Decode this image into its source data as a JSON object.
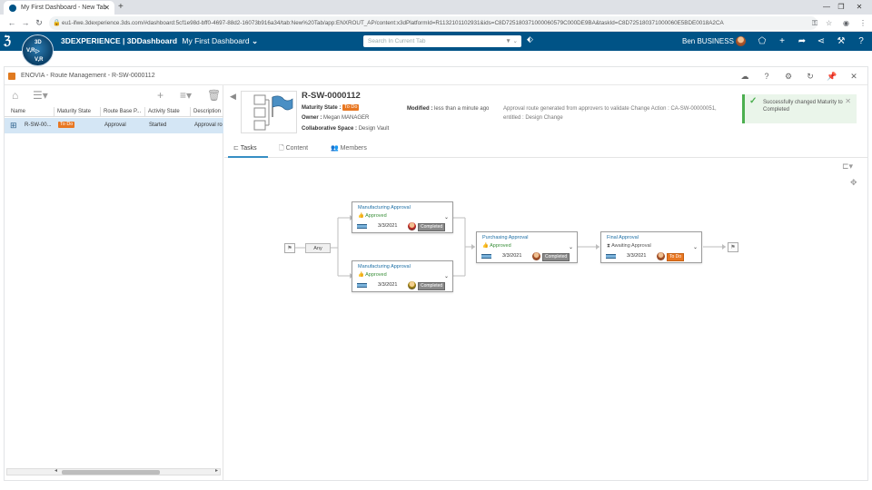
{
  "browser": {
    "tab_title": "My First Dashboard - New Tab",
    "url": "eu1-ifwe.3dexperience.3ds.com/#dashboard:5cf1e98d-bff0-4697-88d2-16073b916a34/tab:New%20Tab/app:ENXROUT_AP/content:x3dPlatformId=R1132101102931&ids=C8D725180371000060579C000DE9BA&taskId=C8D725180371000060E5BDE0018A2CA"
  },
  "topbar": {
    "brand": "3DEXPERIENCE | 3DDashboard",
    "dashboard": "My First Dashboard",
    "search_placeholder": "Search In Current Tab",
    "user": "Ben BUSINESS",
    "compass": {
      "top": "3D",
      "left": "V,R",
      "right": "",
      "bottom": "V,R"
    }
  },
  "app": {
    "title": "ENOVIA - Route Management - R-SW-0000112"
  },
  "list": {
    "columns": [
      "Name",
      "Maturity State",
      "Route Base P...",
      "Activity State",
      "Description"
    ],
    "rows": [
      {
        "name": "R-SW-00...",
        "maturity": "To Do",
        "route_base": "Approval",
        "activity": "Started",
        "description": "Approval ro"
      }
    ]
  },
  "object": {
    "title": "R-SW-0000112",
    "maturity_label": "Maturity State :",
    "maturity_value": "To Do",
    "owner_label": "Owner :",
    "owner_value": "Megan MANAGER",
    "space_label": "Collaborative Space :",
    "space_value": "Design Vault",
    "modified_label": "Modified :",
    "modified_value": "less than a minute ago",
    "description": "Approval route generated from approvers to validate Change Action : CA-SW-00000051, entitled : Design Change"
  },
  "toast": {
    "message": "Successfully changed Maturity to Completed"
  },
  "tabs": [
    {
      "label": "Tasks",
      "active": true
    },
    {
      "label": "Content",
      "active": false
    },
    {
      "label": "Members",
      "active": false
    }
  ],
  "workflow": {
    "any_label": "Any",
    "tasks": [
      {
        "name": "Manufacturing Approval",
        "status": "Approved",
        "date": "3/3/2021",
        "state": "Completed"
      },
      {
        "name": "Manufacturing Approval",
        "status": "Approved",
        "date": "3/3/2021",
        "state": "Completed"
      },
      {
        "name": "Purchasing Approval",
        "status": "Approved",
        "date": "3/3/2021",
        "state": "Completed"
      },
      {
        "name": "Final Approval",
        "status": "Awaiting Approval",
        "date": "3/3/2021",
        "state": "To Do"
      }
    ]
  },
  "colors": {
    "topbar": "#005386",
    "accent": "#368ec4",
    "todo": "#e87722",
    "approved": "#3a8f3a"
  }
}
